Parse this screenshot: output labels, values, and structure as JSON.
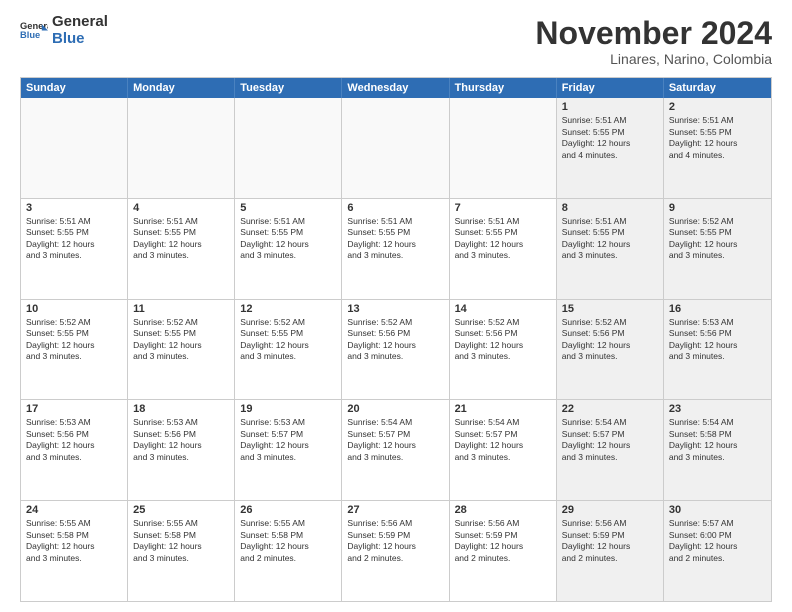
{
  "logo": {
    "line1": "General",
    "line2": "Blue"
  },
  "title": "November 2024",
  "location": "Linares, Narino, Colombia",
  "days_header": [
    "Sunday",
    "Monday",
    "Tuesday",
    "Wednesday",
    "Thursday",
    "Friday",
    "Saturday"
  ],
  "weeks": [
    [
      {
        "day": "",
        "text": ""
      },
      {
        "day": "",
        "text": ""
      },
      {
        "day": "",
        "text": ""
      },
      {
        "day": "",
        "text": ""
      },
      {
        "day": "",
        "text": ""
      },
      {
        "day": "1",
        "text": "Sunrise: 5:51 AM\nSunset: 5:55 PM\nDaylight: 12 hours\nand 4 minutes."
      },
      {
        "day": "2",
        "text": "Sunrise: 5:51 AM\nSunset: 5:55 PM\nDaylight: 12 hours\nand 4 minutes."
      }
    ],
    [
      {
        "day": "3",
        "text": "Sunrise: 5:51 AM\nSunset: 5:55 PM\nDaylight: 12 hours\nand 3 minutes."
      },
      {
        "day": "4",
        "text": "Sunrise: 5:51 AM\nSunset: 5:55 PM\nDaylight: 12 hours\nand 3 minutes."
      },
      {
        "day": "5",
        "text": "Sunrise: 5:51 AM\nSunset: 5:55 PM\nDaylight: 12 hours\nand 3 minutes."
      },
      {
        "day": "6",
        "text": "Sunrise: 5:51 AM\nSunset: 5:55 PM\nDaylight: 12 hours\nand 3 minutes."
      },
      {
        "day": "7",
        "text": "Sunrise: 5:51 AM\nSunset: 5:55 PM\nDaylight: 12 hours\nand 3 minutes."
      },
      {
        "day": "8",
        "text": "Sunrise: 5:51 AM\nSunset: 5:55 PM\nDaylight: 12 hours\nand 3 minutes."
      },
      {
        "day": "9",
        "text": "Sunrise: 5:52 AM\nSunset: 5:55 PM\nDaylight: 12 hours\nand 3 minutes."
      }
    ],
    [
      {
        "day": "10",
        "text": "Sunrise: 5:52 AM\nSunset: 5:55 PM\nDaylight: 12 hours\nand 3 minutes."
      },
      {
        "day": "11",
        "text": "Sunrise: 5:52 AM\nSunset: 5:55 PM\nDaylight: 12 hours\nand 3 minutes."
      },
      {
        "day": "12",
        "text": "Sunrise: 5:52 AM\nSunset: 5:55 PM\nDaylight: 12 hours\nand 3 minutes."
      },
      {
        "day": "13",
        "text": "Sunrise: 5:52 AM\nSunset: 5:56 PM\nDaylight: 12 hours\nand 3 minutes."
      },
      {
        "day": "14",
        "text": "Sunrise: 5:52 AM\nSunset: 5:56 PM\nDaylight: 12 hours\nand 3 minutes."
      },
      {
        "day": "15",
        "text": "Sunrise: 5:52 AM\nSunset: 5:56 PM\nDaylight: 12 hours\nand 3 minutes."
      },
      {
        "day": "16",
        "text": "Sunrise: 5:53 AM\nSunset: 5:56 PM\nDaylight: 12 hours\nand 3 minutes."
      }
    ],
    [
      {
        "day": "17",
        "text": "Sunrise: 5:53 AM\nSunset: 5:56 PM\nDaylight: 12 hours\nand 3 minutes."
      },
      {
        "day": "18",
        "text": "Sunrise: 5:53 AM\nSunset: 5:56 PM\nDaylight: 12 hours\nand 3 minutes."
      },
      {
        "day": "19",
        "text": "Sunrise: 5:53 AM\nSunset: 5:57 PM\nDaylight: 12 hours\nand 3 minutes."
      },
      {
        "day": "20",
        "text": "Sunrise: 5:54 AM\nSunset: 5:57 PM\nDaylight: 12 hours\nand 3 minutes."
      },
      {
        "day": "21",
        "text": "Sunrise: 5:54 AM\nSunset: 5:57 PM\nDaylight: 12 hours\nand 3 minutes."
      },
      {
        "day": "22",
        "text": "Sunrise: 5:54 AM\nSunset: 5:57 PM\nDaylight: 12 hours\nand 3 minutes."
      },
      {
        "day": "23",
        "text": "Sunrise: 5:54 AM\nSunset: 5:58 PM\nDaylight: 12 hours\nand 3 minutes."
      }
    ],
    [
      {
        "day": "24",
        "text": "Sunrise: 5:55 AM\nSunset: 5:58 PM\nDaylight: 12 hours\nand 3 minutes."
      },
      {
        "day": "25",
        "text": "Sunrise: 5:55 AM\nSunset: 5:58 PM\nDaylight: 12 hours\nand 3 minutes."
      },
      {
        "day": "26",
        "text": "Sunrise: 5:55 AM\nSunset: 5:58 PM\nDaylight: 12 hours\nand 2 minutes."
      },
      {
        "day": "27",
        "text": "Sunrise: 5:56 AM\nSunset: 5:59 PM\nDaylight: 12 hours\nand 2 minutes."
      },
      {
        "day": "28",
        "text": "Sunrise: 5:56 AM\nSunset: 5:59 PM\nDaylight: 12 hours\nand 2 minutes."
      },
      {
        "day": "29",
        "text": "Sunrise: 5:56 AM\nSunset: 5:59 PM\nDaylight: 12 hours\nand 2 minutes."
      },
      {
        "day": "30",
        "text": "Sunrise: 5:57 AM\nSunset: 6:00 PM\nDaylight: 12 hours\nand 2 minutes."
      }
    ]
  ]
}
